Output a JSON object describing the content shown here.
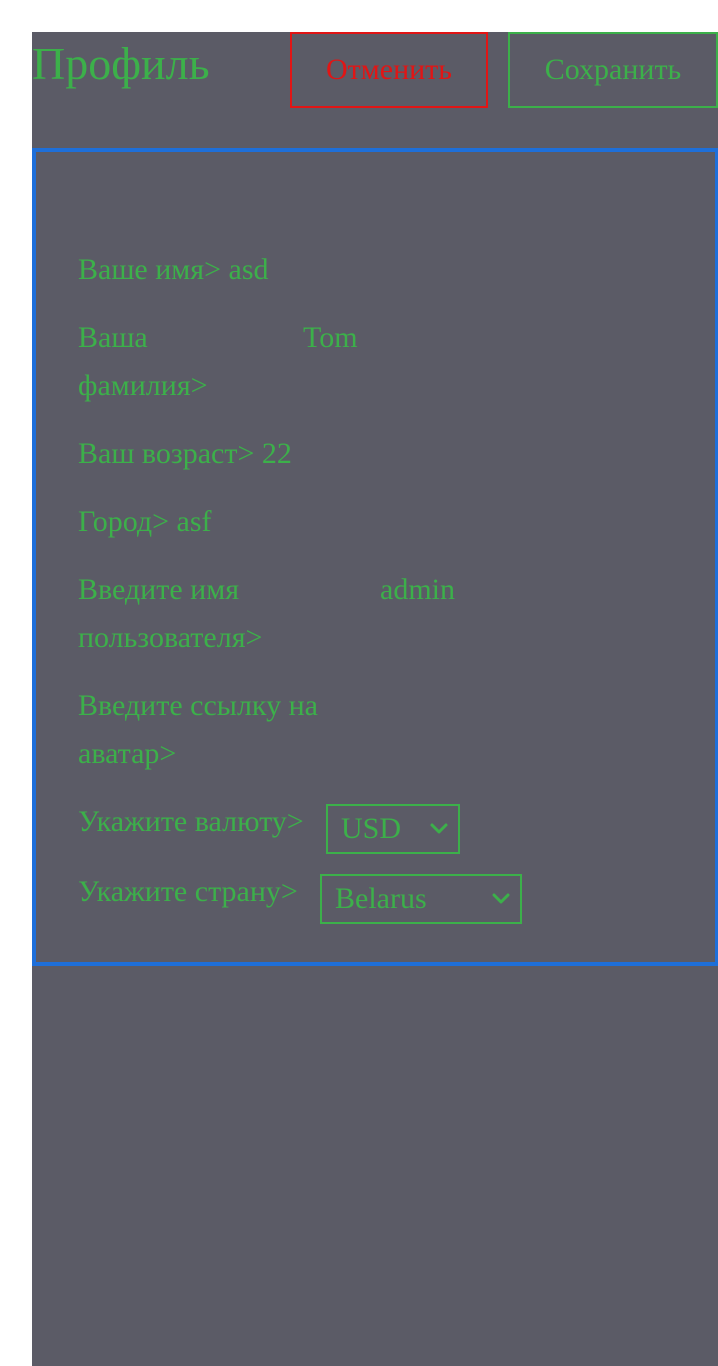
{
  "header": {
    "title": "Профиль",
    "cancel_label": "Отменить",
    "save_label": "Сохранить"
  },
  "form": {
    "first_name": {
      "label": "Ваше имя>",
      "value": "asd"
    },
    "last_name": {
      "label_line1": "Ваша",
      "label_line2": "фамилия>",
      "value": "Tom"
    },
    "age": {
      "label": "Ваш возраст>",
      "value": "22"
    },
    "city": {
      "label": "Город>",
      "value": "asf"
    },
    "username": {
      "label_line1": "Введите имя",
      "label_line2": "пользователя>",
      "value": "admin"
    },
    "avatar": {
      "label_line1": "Введите ссылку на",
      "label_line2": "аватар>",
      "value": ""
    },
    "currency": {
      "label": "Укажите валюту>",
      "selected": "USD"
    },
    "country": {
      "label": "Укажите страну>",
      "selected": "Belarus"
    }
  },
  "colors": {
    "accent_green": "#3cb04a",
    "danger_red": "#e11515",
    "border_blue": "#1e6fd9",
    "background": "#5b5b66"
  },
  "icons": {
    "dropdown": "chevron-down-icon"
  }
}
